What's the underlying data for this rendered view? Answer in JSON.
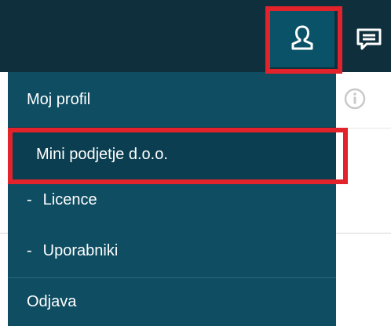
{
  "header": {
    "user_icon": "user-icon",
    "messages_icon": "chat-bubble-icon"
  },
  "content": {
    "info_icon": "info-icon"
  },
  "dropdown": {
    "items": [
      {
        "label": "Moj profil"
      },
      {
        "label": "Mini podjetje d.o.o."
      },
      {
        "label": "Licence",
        "prefix": "-"
      },
      {
        "label": "Uporabniki",
        "prefix": "-"
      },
      {
        "label": "Odjava"
      }
    ]
  },
  "colors": {
    "topbar": "#0e2f3b",
    "user_button": "#0a5268",
    "dropdown_bg": "#0f4d62",
    "selected_bg": "#0a3e50",
    "highlight": "#e3232b"
  }
}
